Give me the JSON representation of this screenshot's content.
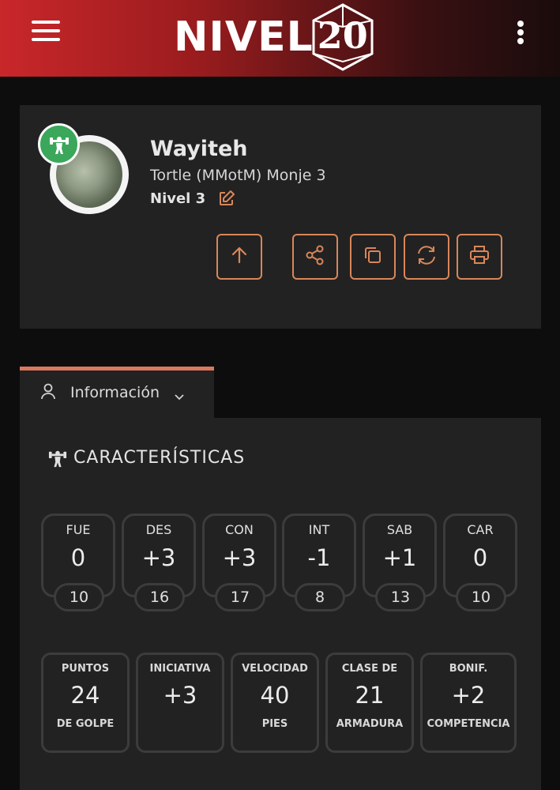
{
  "header": {
    "logo_text": "NIVEL",
    "logo_number": "20",
    "menu_icon": "hamburger-menu-icon",
    "options_icon": "kebab-menu-icon"
  },
  "character": {
    "name": "Wayiteh",
    "subtitle": "Tortle (MMotM) Monje 3",
    "level": "Nivel 3",
    "badge_icon": "weightlifter-icon",
    "actions": [
      {
        "icon": "arrow-up-icon"
      },
      {
        "icon": "share-icon"
      },
      {
        "icon": "copy-icon"
      },
      {
        "icon": "sync-icon"
      },
      {
        "icon": "print-icon"
      }
    ]
  },
  "tab": {
    "label": "Información",
    "icon": "user-icon",
    "accent": "#d9785e"
  },
  "characteristics": {
    "title": "CARACTERÍSTICAS",
    "abilities": [
      {
        "label": "FUE",
        "mod": "0",
        "score": "10"
      },
      {
        "label": "DES",
        "mod": "+3",
        "score": "16"
      },
      {
        "label": "CON",
        "mod": "+3",
        "score": "17"
      },
      {
        "label": "INT",
        "mod": "-1",
        "score": "8"
      },
      {
        "label": "SAB",
        "mod": "+1",
        "score": "13"
      },
      {
        "label": "CAR",
        "mod": "0",
        "score": "10"
      }
    ],
    "stats": [
      {
        "top": "PUNTOS",
        "value": "24",
        "bottom": "DE GOLPE"
      },
      {
        "top": "INICIATIVA",
        "value": "+3",
        "bottom": ""
      },
      {
        "top": "VELOCIDAD",
        "value": "40",
        "bottom": "PIES"
      },
      {
        "top": "CLASE DE",
        "value": "21",
        "bottom": "ARMADURA"
      },
      {
        "top": "BONIF.",
        "value": "+2",
        "bottom": "COMPETENCIA"
      }
    ]
  },
  "colors": {
    "accent_orange": "#d9865a",
    "badge_green": "#3aa75a",
    "header_red": "#c9272a"
  }
}
